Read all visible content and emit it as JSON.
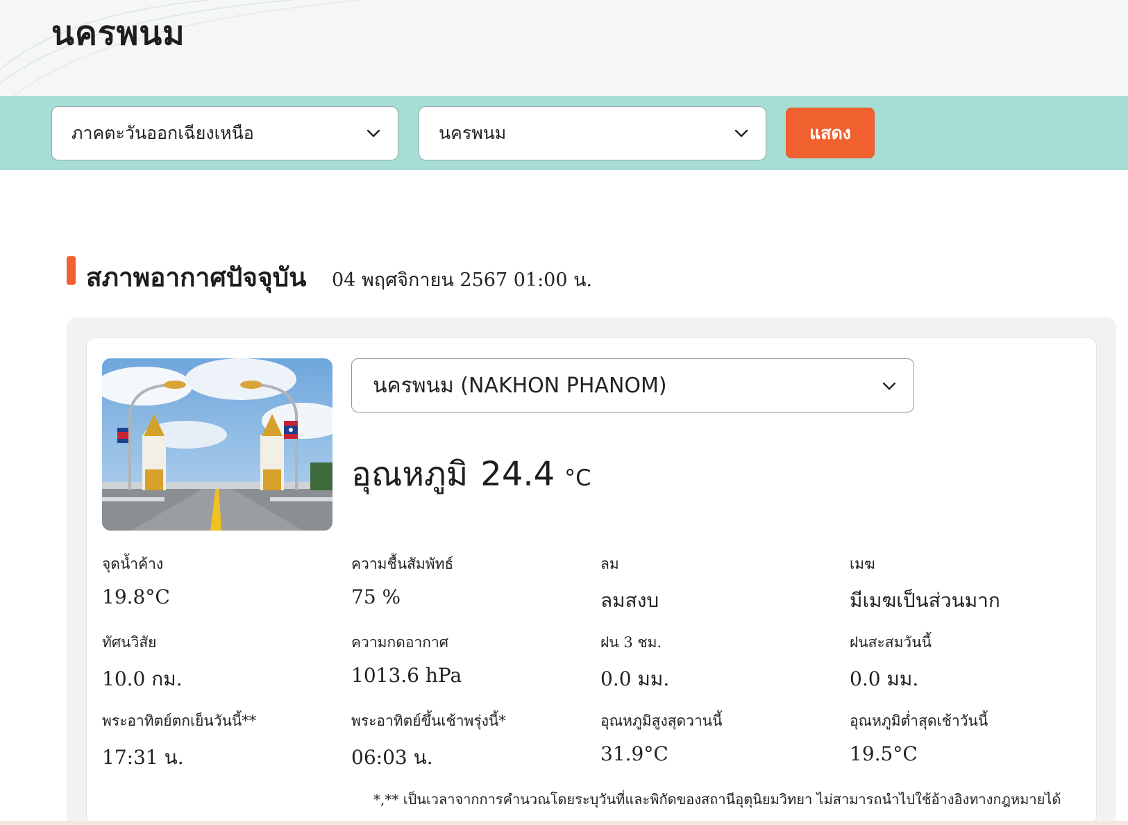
{
  "page": {
    "title": "นครพนม"
  },
  "filters": {
    "region_value": "ภาคตะวันออกเฉียงเหนือ",
    "province_value": "นครพนม",
    "show_label": "แสดง"
  },
  "current": {
    "heading": "สภาพอากาศปัจจุบัน",
    "datetime": "04 พฤศจิกายน 2567 01:00 น.",
    "station_value": "นครพนม (NAKHON PHANOM)",
    "temperature_label": "อุณหภูมิ",
    "temperature_value": "24.4",
    "temperature_unit": "°C",
    "photo_icon": "bridge-photo"
  },
  "stats": [
    {
      "label": "จุดน้ำค้าง",
      "value": "19.8°C"
    },
    {
      "label": "ความชื้นสัมพัทธ์",
      "value": "75 %"
    },
    {
      "label": "ลม",
      "value": "ลมสงบ"
    },
    {
      "label": "เมฆ",
      "value": "มีเมฆเป็นส่วนมาก"
    },
    {
      "label": "ทัศนวิสัย",
      "value": "10.0 กม."
    },
    {
      "label": "ความกดอากาศ",
      "value": "1013.6 hPa"
    },
    {
      "label": "ฝน 3 ชม.",
      "value": "0.0 มม."
    },
    {
      "label": "ฝนสะสมวันนี้",
      "value": "0.0 มม."
    },
    {
      "label": "พระอาทิตย์ตกเย็นวันนี้**",
      "value": "17:31 น."
    },
    {
      "label": "พระอาทิตย์ขึ้นเช้าพรุ่งนี้*",
      "value": "06:03 น."
    },
    {
      "label": "อุณหภูมิสูงสุดวานนี้",
      "value": "31.9°C"
    },
    {
      "label": "อุณหภูมิต่ำสุดเช้าวันนี้",
      "value": "19.5°C"
    }
  ],
  "footnote": "*,** เป็นเวลาจากการคำนวณโดยระบุวันที่และพิกัดของสถานีอุตุนิยมวิทยา ไม่สามารถนำไปใช้อ้างอิงทางกฎหมายได้",
  "colors": {
    "accent": "#f0612f",
    "filter_bar": "#a6ddd5"
  }
}
